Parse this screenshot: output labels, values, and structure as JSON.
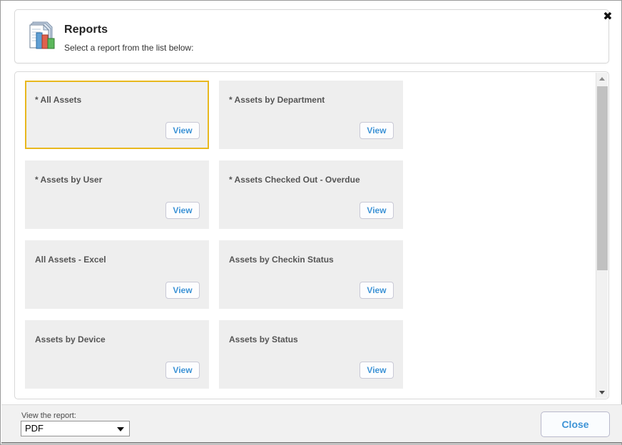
{
  "dialog": {
    "close_x_label": "✖"
  },
  "header": {
    "icon": "report-document-chart-icon",
    "title": "Reports",
    "subtitle": "Select a report from the list below:"
  },
  "reports": [
    {
      "title": "* All Assets",
      "view_label": "View",
      "selected": true
    },
    {
      "title": "* Assets by Department",
      "view_label": "View",
      "selected": false
    },
    {
      "title": "* Assets by User",
      "view_label": "View",
      "selected": false
    },
    {
      "title": "* Assets Checked Out - Overdue",
      "view_label": "View",
      "selected": false
    },
    {
      "title": "All Assets - Excel",
      "view_label": "View",
      "selected": false
    },
    {
      "title": "Assets by Checkin Status",
      "view_label": "View",
      "selected": false
    },
    {
      "title": "Assets by Device",
      "view_label": "View",
      "selected": false
    },
    {
      "title": "Assets by Status",
      "view_label": "View",
      "selected": false
    }
  ],
  "scrollbar": {
    "up_icon": "scroll-up-arrow-icon",
    "down_icon": "scroll-down-arrow-icon",
    "thumb_position_percent": 0,
    "thumb_size_percent": 59
  },
  "footer": {
    "format_label": "View the report:",
    "format_value": "PDF",
    "format_options": [
      "PDF"
    ],
    "close_label": "Close"
  },
  "colors": {
    "accent_link": "#3d93d6",
    "selected_border": "#e8b81e",
    "card_background": "#eeeeee",
    "footer_background": "#f1f1f1",
    "scrollbar_thumb": "#c1c1c1"
  }
}
